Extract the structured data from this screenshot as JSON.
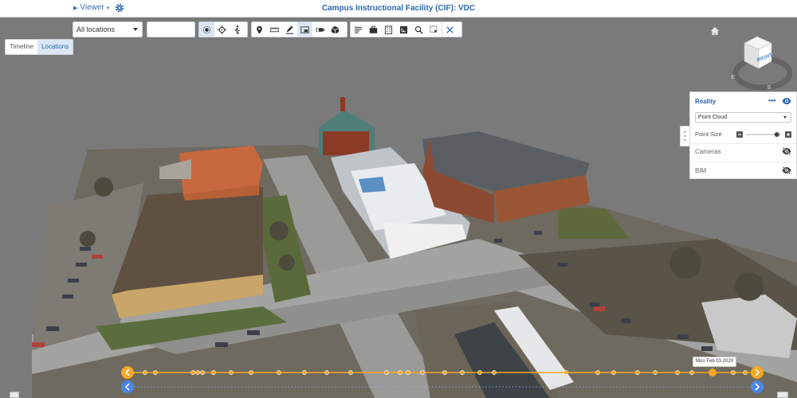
{
  "app": {
    "viewer_menu": "Viewer",
    "title": "Campus Instructional Facility (CIF): VDC"
  },
  "toolbar": {
    "tabs": [
      {
        "label": "Timeline",
        "active": false
      },
      {
        "label": "Locations",
        "active": true
      }
    ],
    "location_select": {
      "value": "All locations",
      "options_visible": [
        "All locations"
      ]
    },
    "search_input": {
      "value": "",
      "placeholder": ""
    },
    "view_tools": [
      "orbit-icon",
      "target-icon",
      "walk-icon"
    ],
    "markup_tools": [
      "pin-icon",
      "tape-measure-icon",
      "pen-icon",
      "camera-image-icon",
      "camera-rotate-icon",
      "cube-icon"
    ],
    "data_tools": [
      "list-icon",
      "briefcase-icon",
      "building-icon",
      "ruler-box-icon",
      "search-icon",
      "select-box-icon"
    ],
    "close_icon": "close-icon"
  },
  "nav_cube": {
    "face_label": "RIGHT",
    "compass": [
      "E",
      "S"
    ]
  },
  "reality_panel": {
    "title": "Reality",
    "more_label": "•••",
    "source_select": "Point Cloud",
    "point_size_label": "Point Size",
    "point_size_level": 0.88,
    "cameras_label": "Cameras",
    "cameras_visible": false,
    "bim_label": "BIM",
    "bim_visible": false
  },
  "timeline": {
    "date_tooltip": "Mon Feb 03 2020",
    "accent_color": "#f5a623",
    "nav_color": "#4a86e8"
  },
  "colors": {
    "brand_blue": "#2c66b0",
    "topbar_bg": "#ffffff",
    "active_bg": "#dbe6f5",
    "viewport_bg": "#7b7b7b"
  }
}
